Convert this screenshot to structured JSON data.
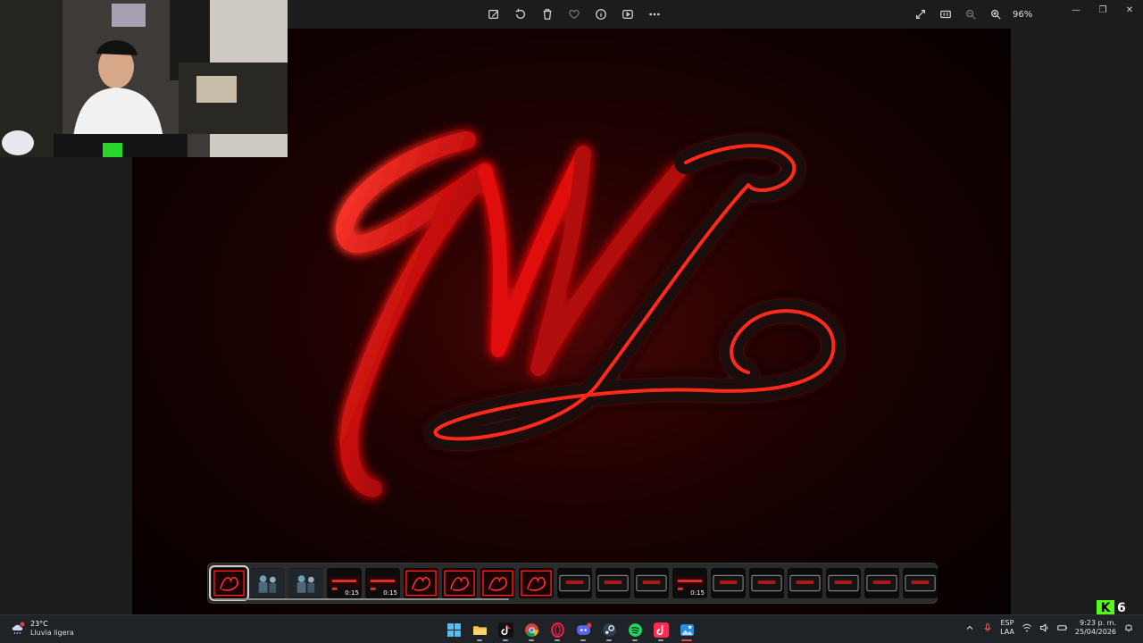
{
  "toolbar": {
    "icons": [
      "edit-icon",
      "rotate-icon",
      "delete-icon",
      "favorite-icon",
      "info-icon",
      "slideshow-icon",
      "more-icon"
    ],
    "right_icons": [
      "fullscreen-icon",
      "actual-size-icon",
      "zoom-out-icon",
      "zoom-in-icon"
    ],
    "zoom_level": "96%"
  },
  "window_controls": {
    "minimize": "—",
    "maximize": "❐",
    "close": "✕"
  },
  "image": {
    "monogram": "WL",
    "glow_color": "#ff1a1a"
  },
  "filmstrip": {
    "thumbs": [
      {
        "kind": "logo",
        "selected": true,
        "duration": ""
      },
      {
        "kind": "people",
        "selected": false,
        "duration": ""
      },
      {
        "kind": "people",
        "selected": false,
        "duration": ""
      },
      {
        "kind": "banner",
        "selected": false,
        "duration": "0:15"
      },
      {
        "kind": "banner",
        "selected": false,
        "duration": "0:15"
      },
      {
        "kind": "logo",
        "selected": false,
        "duration": ""
      },
      {
        "kind": "logo",
        "selected": false,
        "duration": ""
      },
      {
        "kind": "logo",
        "selected": false,
        "duration": ""
      },
      {
        "kind": "logo",
        "selected": false,
        "duration": ""
      },
      {
        "kind": "frame",
        "selected": false,
        "duration": ""
      },
      {
        "kind": "frame",
        "selected": false,
        "duration": ""
      },
      {
        "kind": "frame",
        "selected": false,
        "duration": ""
      },
      {
        "kind": "banner",
        "selected": false,
        "duration": "0:15"
      },
      {
        "kind": "frame",
        "selected": false,
        "duration": ""
      },
      {
        "kind": "frame",
        "selected": false,
        "duration": ""
      },
      {
        "kind": "frame",
        "selected": false,
        "duration": ""
      },
      {
        "kind": "frame",
        "selected": false,
        "duration": ""
      },
      {
        "kind": "frame",
        "selected": false,
        "duration": ""
      },
      {
        "kind": "frame",
        "selected": false,
        "duration": ""
      }
    ]
  },
  "kick_badge": {
    "letter": "K",
    "count": "6"
  },
  "taskbar": {
    "weather": {
      "temp": "23°C",
      "condition": "Lluvia ligera"
    },
    "apps": [
      {
        "name": "windows-start-icon",
        "active": false
      },
      {
        "name": "file-explorer-icon",
        "active": false
      },
      {
        "name": "tiktok-icon",
        "active": false
      },
      {
        "name": "chrome-icon",
        "active": false
      },
      {
        "name": "opera-gx-icon",
        "active": false
      },
      {
        "name": "discord-icon",
        "active": false
      },
      {
        "name": "steam-icon",
        "active": false
      },
      {
        "name": "spotify-icon",
        "active": false
      },
      {
        "name": "tiktok-live-icon",
        "active": false
      },
      {
        "name": "photos-icon",
        "active": true
      }
    ],
    "tray": {
      "language_line1": "ESP",
      "language_line2": "LAA",
      "time": "9:23 p. m.",
      "date": "25/04/2026"
    }
  }
}
